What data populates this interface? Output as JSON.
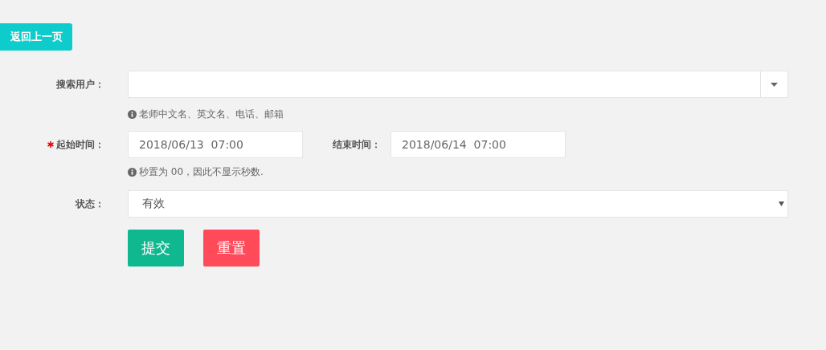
{
  "back_button": {
    "label": "返回上一页"
  },
  "search_user": {
    "label": "搜索用户：",
    "hint": "老师中文名、英文名、电话、邮箱"
  },
  "time": {
    "start": {
      "label": "起始时间：",
      "required": true,
      "value": "2018/06/13  07:00"
    },
    "end": {
      "label": "结束时间：",
      "required": false,
      "value": "2018/06/14  07:00"
    },
    "hint": "秒置为 00，因此不显示秒数."
  },
  "status": {
    "label": "状态：",
    "value": "有效"
  },
  "buttons": [
    {
      "label": "提交",
      "kind": "submit"
    },
    {
      "label": "重置",
      "kind": "reset"
    }
  ]
}
